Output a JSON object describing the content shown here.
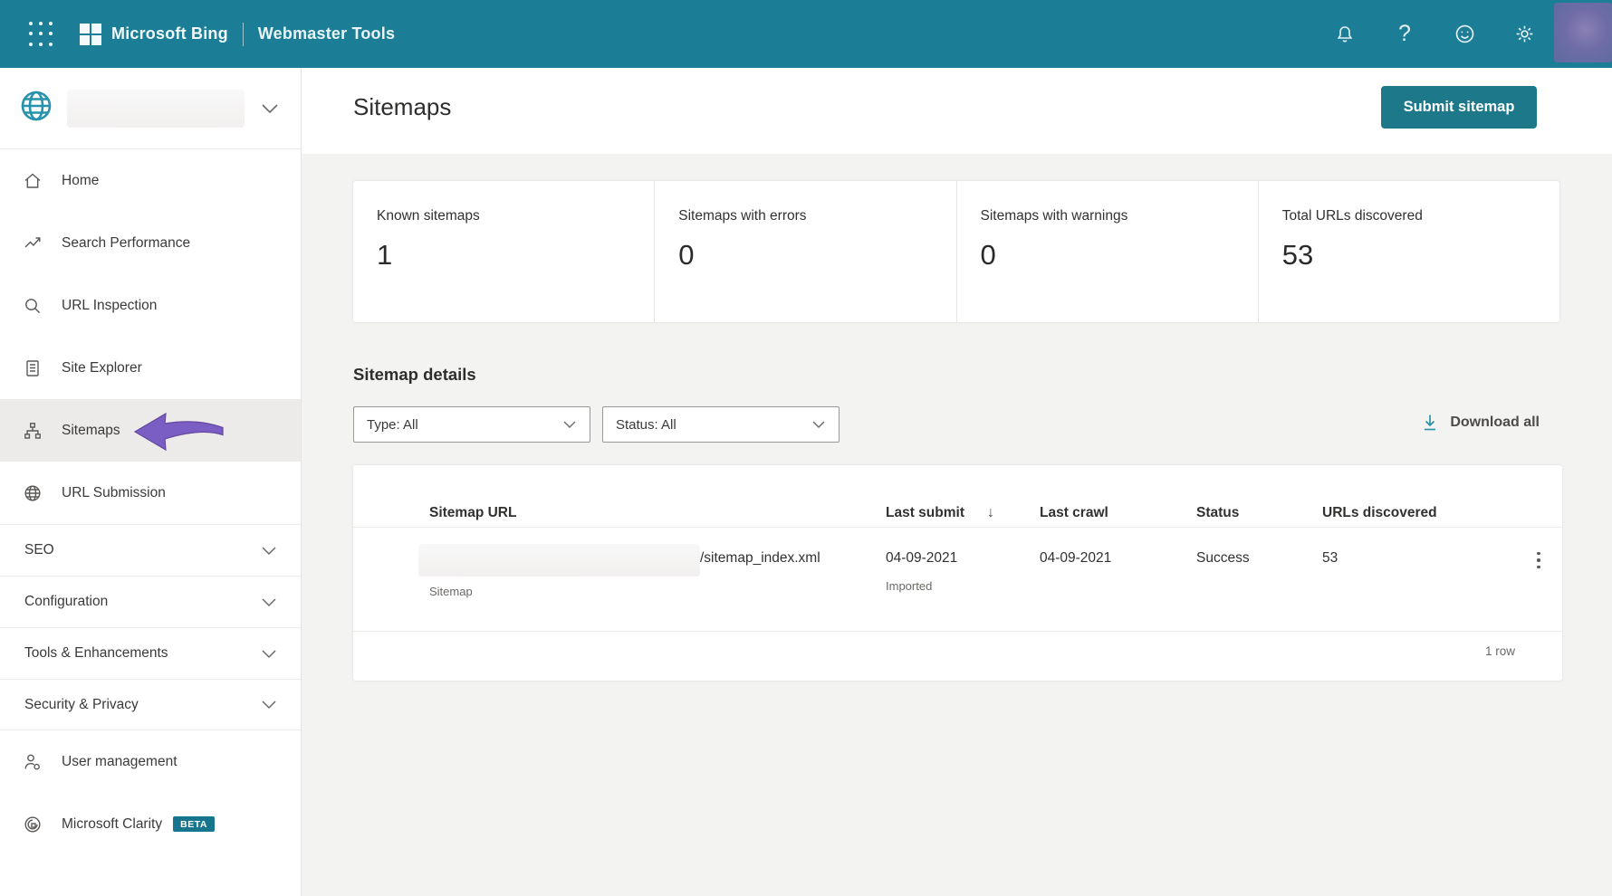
{
  "header": {
    "brand": "Microsoft Bing",
    "suite": "Webmaster Tools",
    "help_glyph": "?"
  },
  "sidebar": {
    "items": [
      {
        "label": "Home"
      },
      {
        "label": "Search Performance"
      },
      {
        "label": "URL Inspection"
      },
      {
        "label": "Site Explorer"
      },
      {
        "label": "Sitemaps"
      },
      {
        "label": "URL Submission"
      }
    ],
    "groups": [
      {
        "label": "SEO"
      },
      {
        "label": "Configuration"
      },
      {
        "label": "Tools & Enhancements"
      },
      {
        "label": "Security & Privacy"
      }
    ],
    "footer_items": [
      {
        "label": "User management"
      },
      {
        "label": "Microsoft Clarity",
        "badge": "BETA"
      }
    ]
  },
  "page": {
    "title": "Sitemaps",
    "submit_button": "Submit sitemap"
  },
  "stats": [
    {
      "label": "Known sitemaps",
      "value": "1"
    },
    {
      "label": "Sitemaps with errors",
      "value": "0"
    },
    {
      "label": "Sitemaps with warnings",
      "value": "0"
    },
    {
      "label": "Total URLs discovered",
      "value": "53"
    }
  ],
  "details": {
    "heading": "Sitemap details",
    "type_filter": "Type: All",
    "status_filter": "Status: All",
    "download_all": "Download all",
    "sort_glyph": "↓"
  },
  "table": {
    "columns": [
      "Sitemap URL",
      "Last submit",
      "Last crawl",
      "Status",
      "URLs discovered"
    ],
    "row": {
      "url_suffix": "/sitemap_index.xml",
      "url_type": "Sitemap",
      "last_submit": "04-09-2021",
      "last_submit_note": "Imported",
      "last_crawl": "04-09-2021",
      "status": "Success",
      "urls_discovered": "53"
    },
    "footer": "1 row"
  },
  "colors": {
    "header_teal": "#1b7e96",
    "button_teal": "#1d7889",
    "beta_badge_teal": "#17768d",
    "arrow_purple": "#7b5ec3",
    "selected_item_bg": "#ecebe9",
    "content_bg": "#f3f3f2"
  }
}
